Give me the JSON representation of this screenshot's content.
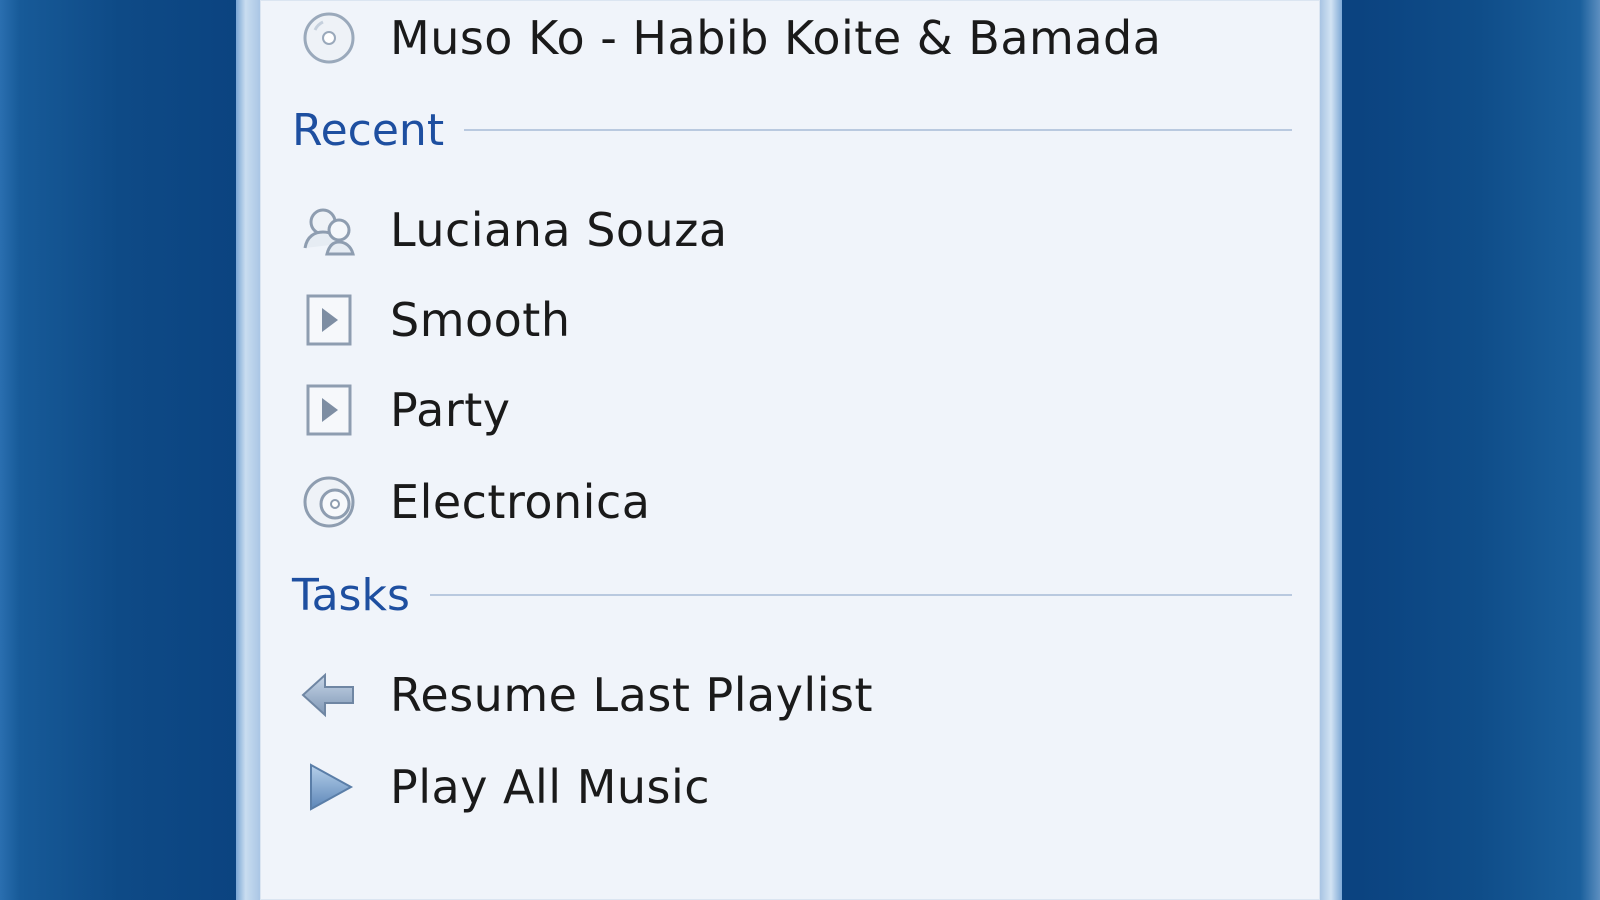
{
  "jumplist": {
    "pinned": [
      {
        "label": "Muso Ko - Habib Koite & Bamada",
        "icon": "disc-icon"
      }
    ],
    "recent": {
      "title": "Recent",
      "items": [
        {
          "label": "Luciana Souza",
          "icon": "artist-icon"
        },
        {
          "label": "Smooth",
          "icon": "playlist-icon"
        },
        {
          "label": "Party",
          "icon": "playlist-icon"
        },
        {
          "label": "Electronica",
          "icon": "genre-icon"
        }
      ]
    },
    "tasks": {
      "title": "Tasks",
      "items": [
        {
          "label": "Resume Last Playlist",
          "icon": "back-arrow-icon"
        },
        {
          "label": "Play All Music",
          "icon": "play-icon"
        }
      ]
    }
  },
  "colors": {
    "desktop": "#0b4380",
    "panel": "#f0f4fa",
    "section_title": "#1e4fa0",
    "rule": "#b9c9df"
  }
}
